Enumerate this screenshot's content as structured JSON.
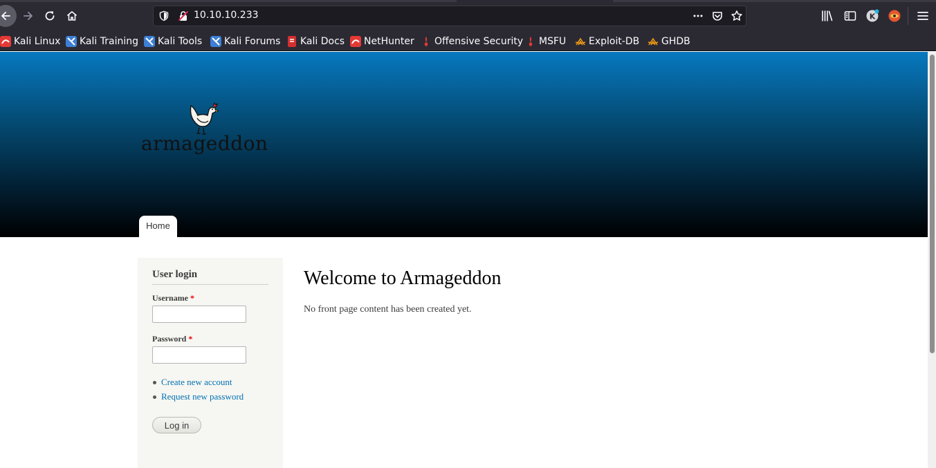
{
  "browser": {
    "url": "10.10.10.233",
    "bookmarks": [
      {
        "label": "Kali Linux",
        "icon": "kali-icon"
      },
      {
        "label": "Kali Training",
        "icon": "kali-training-icon"
      },
      {
        "label": "Kali Tools",
        "icon": "kali-tools-icon"
      },
      {
        "label": "Kali Forums",
        "icon": "kali-forums-icon"
      },
      {
        "label": "Kali Docs",
        "icon": "kali-docs-icon"
      },
      {
        "label": "NetHunter",
        "icon": "nethunter-icon"
      },
      {
        "label": "Offensive Security",
        "icon": "offsec-icon"
      },
      {
        "label": "MSFU",
        "icon": "msfu-icon"
      },
      {
        "label": "Exploit-DB",
        "icon": "exploitdb-icon"
      },
      {
        "label": "GHDB",
        "icon": "ghdb-icon"
      }
    ]
  },
  "site": {
    "name": "armageddon",
    "nav": {
      "home": "Home"
    }
  },
  "login": {
    "title": "User login",
    "username_label": "Username",
    "password_label": "Password",
    "required_mark": "*",
    "username_value": "",
    "password_value": "",
    "links": [
      "Create new account",
      "Request new password"
    ],
    "submit": "Log in"
  },
  "main": {
    "title": "Welcome to Armageddon",
    "text": "No front page content has been created yet."
  },
  "colors": {
    "header_top": "#0779bf",
    "header_bottom": "#000000",
    "link": "#0071b3",
    "required": "#ee0000"
  }
}
